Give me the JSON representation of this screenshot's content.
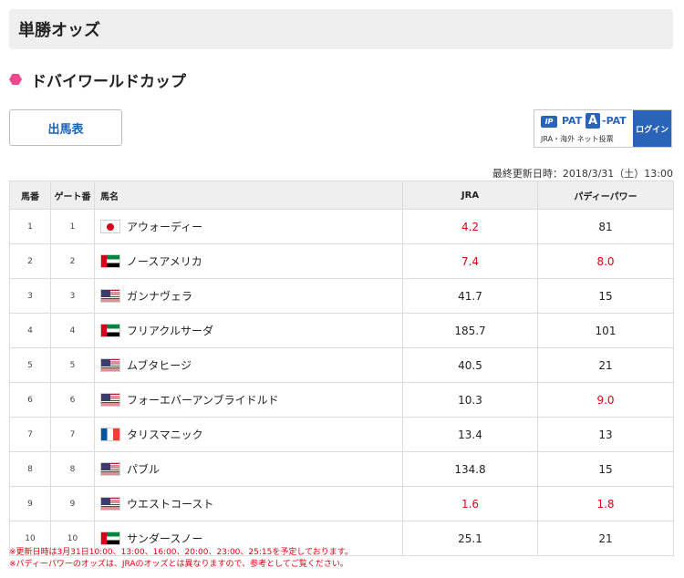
{
  "header": {
    "title": "単勝オッズ"
  },
  "race": {
    "name": "ドバイワールドカップ",
    "marker_color": "#ee4b8f"
  },
  "buttons": {
    "entries_label": "出馬表"
  },
  "pat_banner": {
    "ip_badge": "IP",
    "pat_label": "PAT",
    "a_badge": "A",
    "apat_label": "-PAT",
    "sub_label": "JRA・海外 ネット投票",
    "login_label": "ログイン",
    "accent": "#2a64b8"
  },
  "updated": {
    "text": "最終更新日時：2018/3/31（土）13:00"
  },
  "table": {
    "headers": {
      "horse_no": "馬番",
      "gate_no": "ゲート番",
      "name": "馬名",
      "jra": "JRA",
      "buddy": "パディーパワー"
    },
    "rows": [
      {
        "horse_no": "1",
        "gate_no": "1",
        "flag": "jp-flag-icon",
        "name": "アウォーディー",
        "jra": "4.2",
        "jra_red": true,
        "buddy": "81",
        "buddy_red": false
      },
      {
        "horse_no": "2",
        "gate_no": "2",
        "flag": "ae-flag-icon",
        "name": "ノースアメリカ",
        "jra": "7.4",
        "jra_red": true,
        "buddy": "8.0",
        "buddy_red": true
      },
      {
        "horse_no": "3",
        "gate_no": "3",
        "flag": "us-flag-icon",
        "name": " ガンナヴェラ",
        "jra": "41.7",
        "jra_red": false,
        "buddy": "15",
        "buddy_red": false
      },
      {
        "horse_no": "4",
        "gate_no": "4",
        "flag": "ae-flag-icon",
        "name": "フリアクルサーダ",
        "jra": "185.7",
        "jra_red": false,
        "buddy": "101",
        "buddy_red": false
      },
      {
        "horse_no": "5",
        "gate_no": "5",
        "flag": "us-flag-icon",
        "name": "ムブタヒージ",
        "jra": "40.5",
        "jra_red": false,
        "buddy": "21",
        "buddy_red": false
      },
      {
        "horse_no": "6",
        "gate_no": "6",
        "flag": "us-flag-icon",
        "name": "フォーエバーアンブライドルド",
        "jra": "10.3",
        "jra_red": false,
        "buddy": "9.0",
        "buddy_red": true
      },
      {
        "horse_no": "7",
        "gate_no": "7",
        "flag": "fr-flag-icon",
        "name": "タリスマニック",
        "jra": "13.4",
        "jra_red": false,
        "buddy": "13",
        "buddy_red": false
      },
      {
        "horse_no": "8",
        "gate_no": "8",
        "flag": "us-flag-icon",
        "name": "パブル",
        "jra": "134.8",
        "jra_red": false,
        "buddy": "15",
        "buddy_red": false
      },
      {
        "horse_no": "9",
        "gate_no": "9",
        "flag": "us-flag-icon",
        "name": "ウエストコースト",
        "jra": "1.6",
        "jra_red": true,
        "buddy": "1.8",
        "buddy_red": true
      },
      {
        "horse_no": "10",
        "gate_no": "10",
        "flag": "ae-flag-icon",
        "name": "サンダースノー",
        "jra": "25.1",
        "jra_red": false,
        "buddy": "21",
        "buddy_red": false
      }
    ]
  },
  "notes": [
    "※更新日時は3月31日10:00、13:00、16:00、20:00、23:00、25:15を予定しております。",
    "※パディーパワーのオッズは、JRAのオッズとは異なりますので、参考としてご覧ください。"
  ],
  "colors": {
    "highlight_red": "#e60012",
    "header_bg": "#efefef",
    "border": "#dcdcdc"
  }
}
